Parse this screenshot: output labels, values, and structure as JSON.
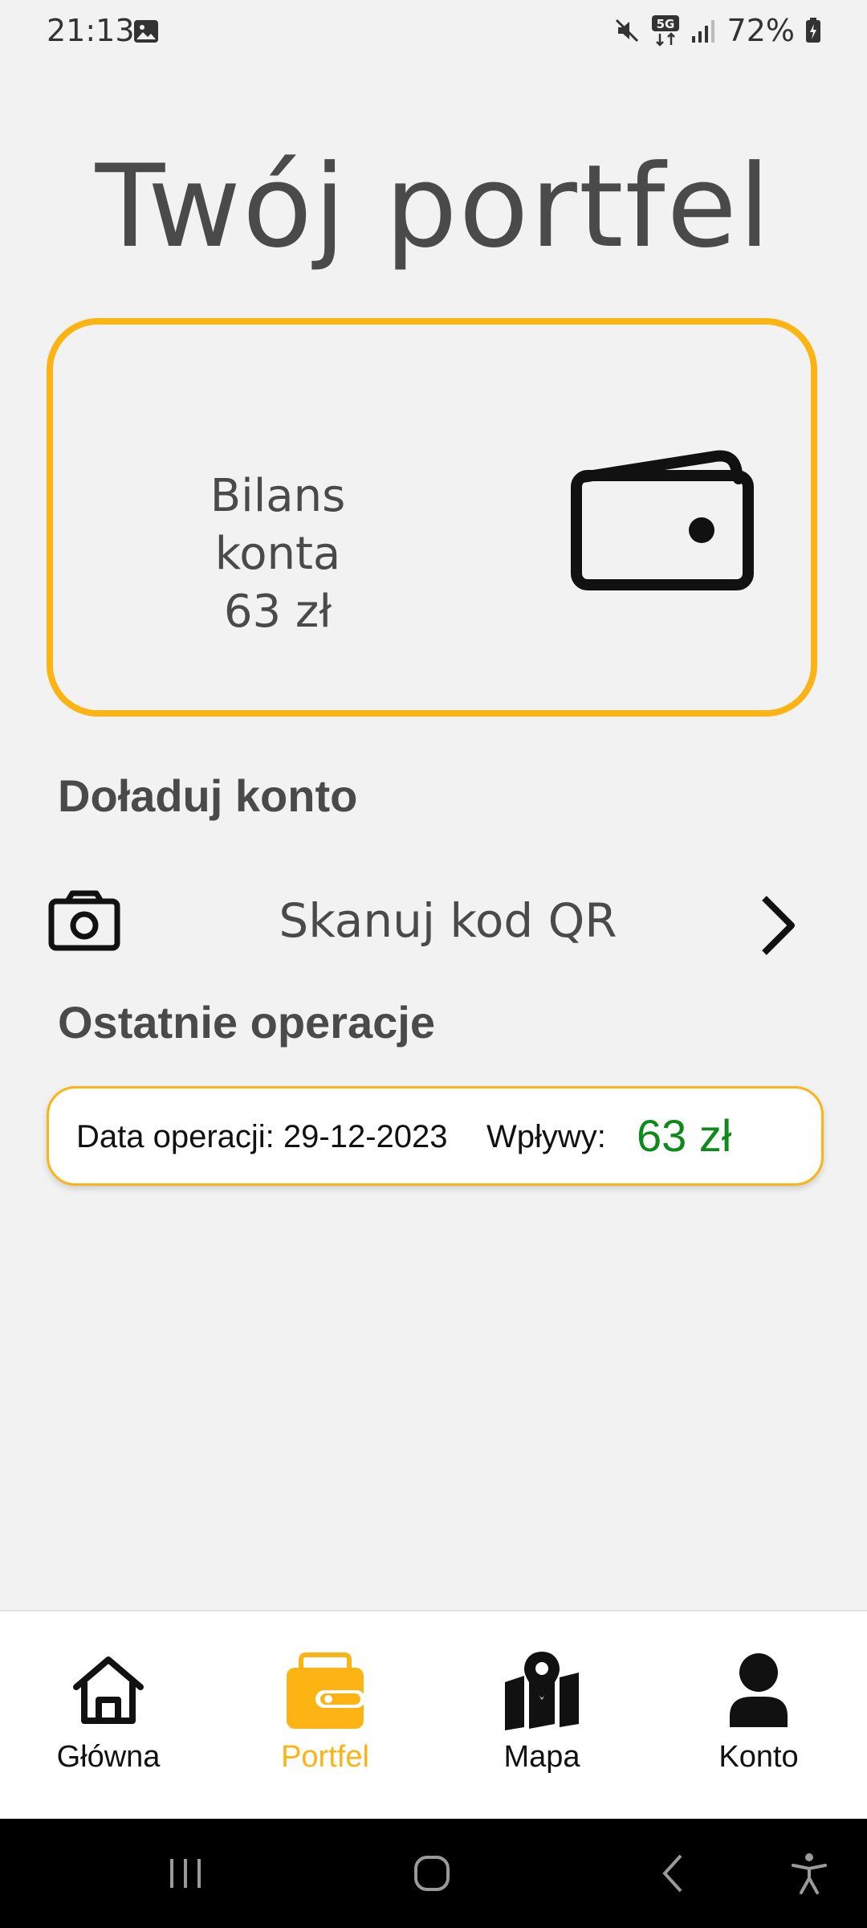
{
  "status_bar": {
    "time": "21:13",
    "battery": "72%"
  },
  "page": {
    "title": "Twój portfel"
  },
  "balance": {
    "label": "Bilans konta",
    "amount": "63 zł"
  },
  "topup": {
    "section_title": "Doładuj konto",
    "scan_label": "Skanuj kod QR"
  },
  "operations": {
    "section_title": "Ostatnie operacje",
    "items": [
      {
        "date_text": "Data operacji: 29-12-2023",
        "type_label": "Wpływy:",
        "amount": "63 zł"
      }
    ]
  },
  "bottom_nav": {
    "items": [
      {
        "label": "Główna",
        "icon": "home-icon",
        "active": false
      },
      {
        "label": "Portfel",
        "icon": "wallet-icon",
        "active": true
      },
      {
        "label": "Mapa",
        "icon": "map-icon",
        "active": false
      },
      {
        "label": "Konto",
        "icon": "person-icon",
        "active": false
      }
    ]
  },
  "colors": {
    "accent": "#fbb414",
    "income": "#0e8a1a",
    "text": "#4a4a4a",
    "background": "#f2f2f2"
  }
}
